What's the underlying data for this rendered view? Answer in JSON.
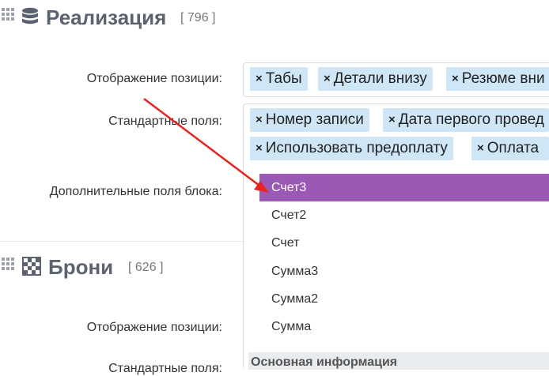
{
  "section1": {
    "title": "Реализация",
    "count": "[ 796 ]"
  },
  "section2": {
    "title": "Брони",
    "count": "[ 626 ]"
  },
  "labels": {
    "display_position": "Отображение позиции:",
    "standard_fields": "Стандартные поля:",
    "block_extra_fields": "Дополнительные поля блока:",
    "display_position_2": "Отображение позиции:",
    "standard_fields_2": "Стандартные поля:"
  },
  "display_tags": [
    "Табы",
    "Детали внизу",
    "Резюме вни"
  ],
  "standard_tags": [
    "Номер записи",
    "Дата первого провед",
    "Использовать предоплату",
    "Оплата"
  ],
  "tag_remove_symbol": "×",
  "dropdown": {
    "options": [
      "Счет3",
      "Счет2",
      "Счет",
      "Сумма3",
      "Сумма2",
      "Сумма"
    ],
    "selected_index": 0,
    "group_header": "Основная информация"
  },
  "colors": {
    "tag_bg": "#cfe6f7",
    "dropdown_highlight": "#9b59b6",
    "arrow": "#e8231f",
    "title_gray": "#5c6370"
  },
  "icons": {
    "drag": "grip-icon",
    "section1": "database-icon",
    "section2": "chessboard-icon",
    "remove": "close-icon"
  }
}
